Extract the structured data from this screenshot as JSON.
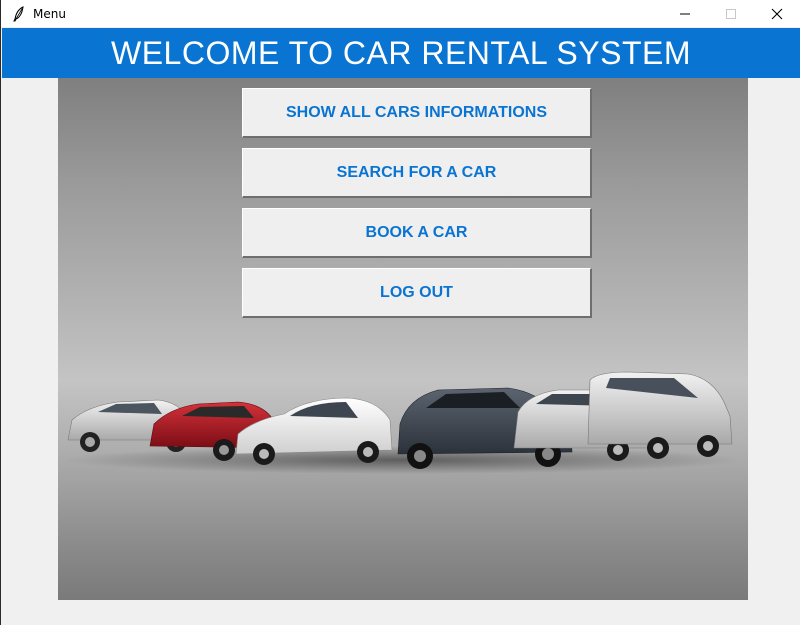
{
  "window": {
    "title": "Menu",
    "controls": {
      "minimize": "minimize-icon",
      "maximize": "maximize-icon",
      "close": "close-icon"
    }
  },
  "banner": {
    "text": "WELCOME TO CAR RENTAL SYSTEM",
    "color": "#0a74d2"
  },
  "menu": {
    "items": [
      {
        "label": "SHOW ALL CARS INFORMATIONS"
      },
      {
        "label": "SEARCH FOR A CAR"
      },
      {
        "label": "BOOK A CAR"
      },
      {
        "label": "LOG OUT"
      }
    ]
  },
  "illustration": {
    "subject": "row-of-cars-icon",
    "cars": [
      "silver-hatchback",
      "red-hatchback",
      "white-sedan",
      "dark-suv",
      "silver-compact",
      "silver-minivan"
    ]
  }
}
